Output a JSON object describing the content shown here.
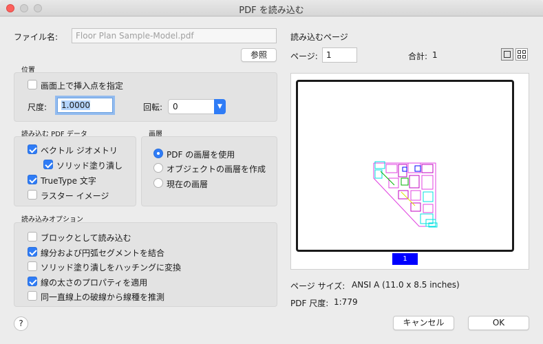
{
  "window": {
    "title": "PDF を読み込む"
  },
  "file": {
    "label": "ファイル名:",
    "value": "Floor Plan Sample-Model.pdf",
    "browse_label": "参照"
  },
  "position": {
    "section_label": "位置",
    "specify_on_screen": {
      "label": "画面上で挿入点を指定",
      "checked": false
    },
    "scale_label": "尺度:",
    "scale_value": "1.0000",
    "rotation_label": "回転:",
    "rotation_value": "0"
  },
  "pdf_data": {
    "section_label": "読み込む PDF データ",
    "items": [
      {
        "label": "ベクトル ジオメトリ",
        "checked": true
      },
      {
        "label": "ソリッド塗り潰し",
        "checked": true
      },
      {
        "label": "TrueType 文字",
        "checked": true
      },
      {
        "label": "ラスター イメージ",
        "checked": false
      }
    ]
  },
  "layers": {
    "section_label": "画層",
    "options": [
      {
        "label": "PDF の画層を使用",
        "selected": true
      },
      {
        "label": "オブジェクトの画層を作成",
        "selected": false
      },
      {
        "label": "現在の画層",
        "selected": false
      }
    ]
  },
  "import_options": {
    "section_label": "読み込みオプション",
    "items": [
      {
        "label": "ブロックとして読み込む",
        "checked": false
      },
      {
        "label": "線分および円弧セグメントを結合",
        "checked": true
      },
      {
        "label": "ソリッド塗り潰しをハッチングに変換",
        "checked": false
      },
      {
        "label": "線の太さのプロパティを適用",
        "checked": true
      },
      {
        "label": "同一直線上の破線から線種を推測",
        "checked": false
      }
    ]
  },
  "pages": {
    "heading": "読み込むページ",
    "page_label": "ページ:",
    "page_value": "1",
    "total_label": "合計:",
    "total_value": "1",
    "thumbnail_label": "1"
  },
  "info": {
    "page_size_label": "ページ サイズ:",
    "page_size_value": "ANSI A (11.0 x 8.5 inches)",
    "pdf_scale_label": "PDF 尺度:",
    "pdf_scale_value": "1:779"
  },
  "buttons": {
    "help": "?",
    "cancel": "キャンセル",
    "ok": "OK"
  },
  "colors": {
    "accent": "#2f7cf6",
    "page_tab": "#0000ff"
  }
}
